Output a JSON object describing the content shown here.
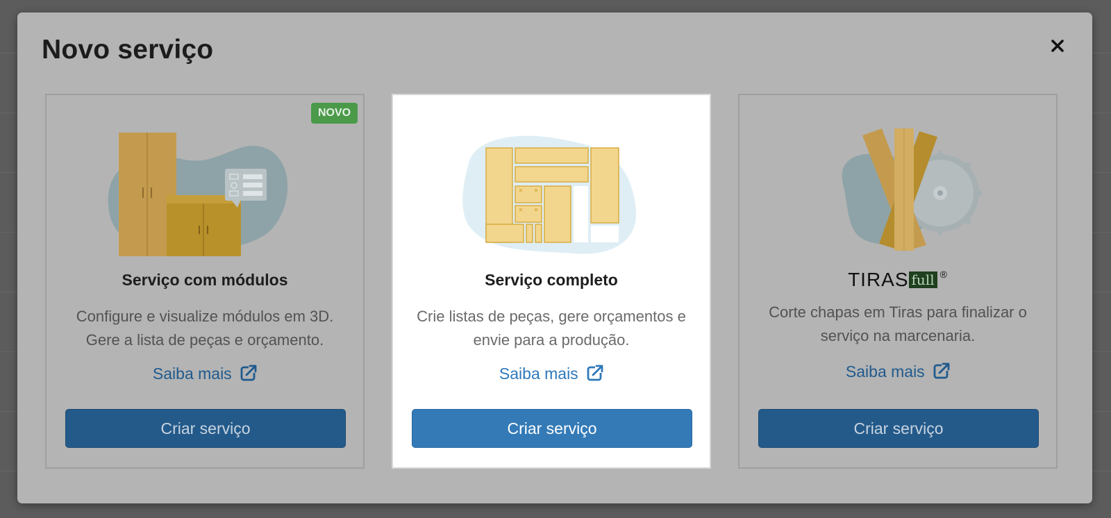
{
  "modal": {
    "title": "Novo serviço",
    "close_icon": "close-icon"
  },
  "cards": [
    {
      "title": "Serviço com módulos",
      "badge": "NOVO",
      "description": "Configure e visualize módulos em 3D. Gere a lista de peças e orçamento.",
      "link_label": "Saiba mais",
      "link_icon": "external-link-icon",
      "button_label": "Criar serviço",
      "illustration_icon": "cabinet-modules-icon"
    },
    {
      "title": "Serviço completo",
      "description": "Crie listas de peças, gere orçamentos e envie para a produção.",
      "link_label": "Saiba mais",
      "link_icon": "external-link-icon",
      "button_label": "Criar serviço",
      "illustration_icon": "cut-plan-icon",
      "highlighted": true
    },
    {
      "logo_text": "TIRAS",
      "logo_suffix": "full",
      "logo_mark": "®",
      "description": "Corte chapas em Tiras para finalizar o serviço na marcenaria.",
      "link_label": "Saiba mais",
      "link_icon": "external-link-icon",
      "button_label": "Criar serviço",
      "illustration_icon": "wood-strips-saw-icon"
    }
  ],
  "colors": {
    "primary_button": "#337ab7",
    "link": "#2f78ba",
    "badge_green": "#4a9a4a",
    "wood": "#f3d68d"
  }
}
